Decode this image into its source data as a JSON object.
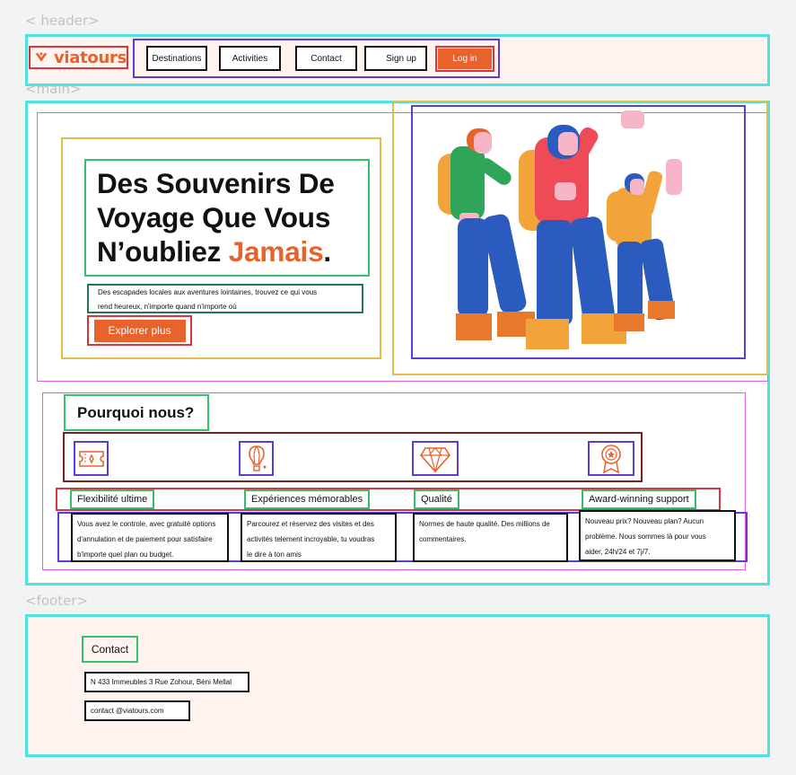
{
  "annotations": {
    "header": "< header>",
    "main": "<main>",
    "footer": "<footer>"
  },
  "header": {
    "logo_text": "viatours",
    "nav": [
      "Destinations",
      "Activities",
      "Contact",
      "Sign up"
    ],
    "login_label": "Log in"
  },
  "hero": {
    "title_line1": "Des Souvenirs De",
    "title_line2": "Voyage Que Vous",
    "title_line3_plain": "N’oubliez ",
    "title_line3_accent": "Jamais",
    "title_line3_end": ".",
    "desc_line1": "Des escapades locales aux aventures lointaines, trouvez ce qui vous",
    "desc_line2": "rend heureux, n'importe quand n'importe où",
    "button": "Explorer plus",
    "image_icon": "travelers-illustration-icon"
  },
  "why": {
    "title": "Pourquoi nous?",
    "features": [
      {
        "icon": "ticket-icon",
        "title": "Flexibilité ultime",
        "text1": "Vous avez le controle, avec gratuité options",
        "text2": "d'annulation et de paiement pour satisfaire",
        "text3": "b'importe quel plan ou budget."
      },
      {
        "icon": "hot-air-balloon-icon",
        "title": "Expériences mémorables",
        "text1": "Parcourez et réservez des visites et des",
        "text2": "activités telement incroyable, tu voudras",
        "text3": "le dire à ton amis"
      },
      {
        "icon": "diamond-icon",
        "title": "Qualité",
        "text1": "Normes de haute qualité. Des millions de",
        "text2": "commentaires.",
        "text3": ""
      },
      {
        "icon": "award-badge-icon",
        "title": "Award-winning support",
        "text1": "Nouveau prix? Nouveau plan? Aucun",
        "text2": "problème. Nous sommes là pour vous",
        "text3": "aider, 24h/24 et 7j/7."
      }
    ]
  },
  "footer": {
    "title": "Contact",
    "address": "N 433 Immeubles 3 Rue Zohour, Béni Mellal",
    "email": "contact @viatours.com"
  },
  "colors": {
    "accent": "#e8622b",
    "panel": "#fff3ef",
    "outline_section": "#4fe3e0"
  }
}
